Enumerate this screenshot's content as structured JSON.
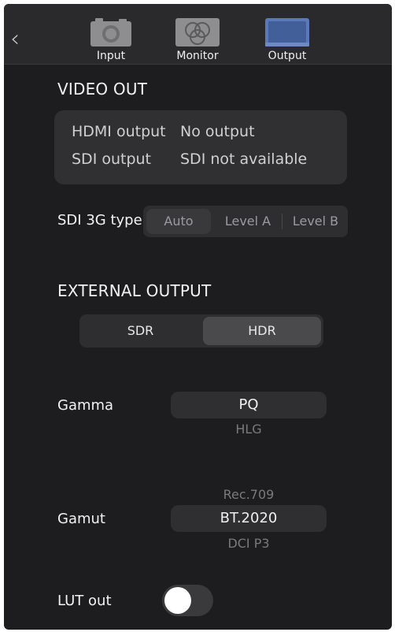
{
  "header": {
    "tabs": [
      {
        "label": "Input",
        "icon": "camera-icon"
      },
      {
        "label": "Monitor",
        "icon": "monitor-logo-icon"
      },
      {
        "label": "Output",
        "icon": "output-screen-icon",
        "active": true
      }
    ]
  },
  "video_out": {
    "title": "VIDEO OUT",
    "rows": [
      {
        "label": "HDMI output",
        "value": "No output"
      },
      {
        "label": "SDI output",
        "value": "SDI not available"
      }
    ]
  },
  "sdi_3g": {
    "label": "SDI 3G type",
    "options": [
      "Auto",
      "Level A",
      "Level B"
    ],
    "selected": "Auto"
  },
  "external_output": {
    "title": "EXTERNAL OUTPUT",
    "options": [
      "SDR",
      "HDR"
    ],
    "selected": "HDR"
  },
  "gamma": {
    "label": "Gamma",
    "selected": "PQ",
    "below": "HLG"
  },
  "gamut": {
    "label": "Gamut",
    "above": "Rec.709",
    "selected": "BT.2020",
    "below": "DCI P3"
  },
  "lut_out": {
    "label": "LUT out",
    "on": false
  },
  "colors": {
    "background": "#1d1d1f",
    "topbar": "#2a2a2c",
    "accent": "#4a6fb5"
  }
}
